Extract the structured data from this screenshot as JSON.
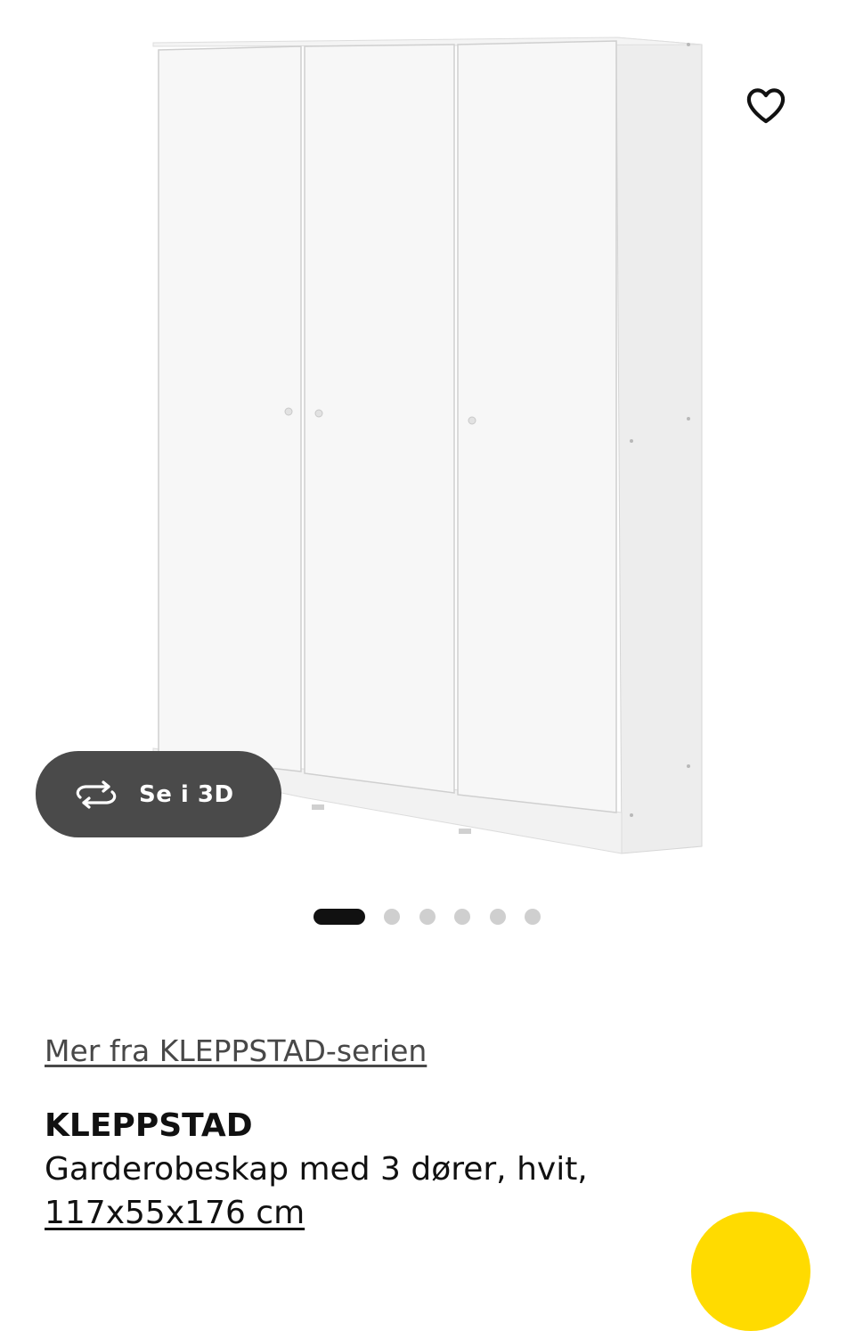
{
  "gallery": {
    "view3d_label": "Se i 3D",
    "icons": {
      "favorite": "heart-outline-icon",
      "view3d": "rotate-3d-icon"
    },
    "active_slide": 1,
    "slide_count": 6
  },
  "product": {
    "series_link": "Mer fra KLEPPSTAD-serien",
    "name": "KLEPPSTAD",
    "description": "Garderobeskap med 3 dører, hvit,",
    "size": "117x55x176 cm"
  },
  "colors": {
    "accent_yellow": "#ffdb00",
    "pill_background": "#4a4a4a",
    "dot_active": "#111111",
    "dot_inactive": "#cfcfcf"
  }
}
